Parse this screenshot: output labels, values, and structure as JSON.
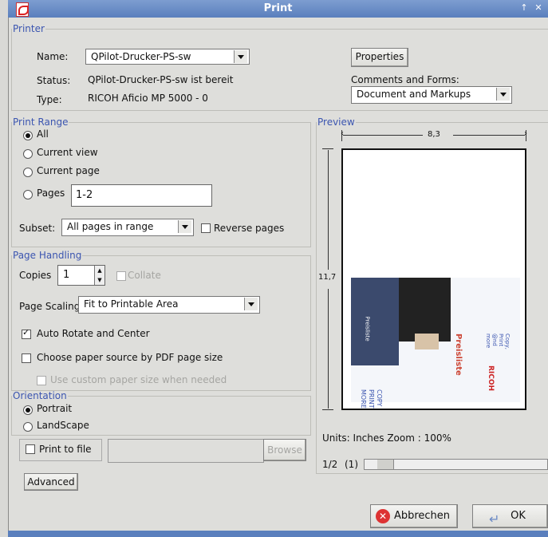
{
  "window": {
    "title": "Print",
    "min_label": "↑",
    "close_label": "✕"
  },
  "printer": {
    "legend": "Printer",
    "name_label": "Name:",
    "name_value": "QPilot-Drucker-PS-sw",
    "status_label": "Status:",
    "status_value": "QPilot-Drucker-PS-sw ist bereit",
    "type_label": "Type:",
    "type_value": "RICOH Aficio MP 5000 -  0",
    "properties_button": "Properties",
    "comments_label": "Comments and Forms:",
    "comments_value": "Document and Markups"
  },
  "print_range": {
    "legend": "Print Range",
    "all": "All",
    "current_view": "Current view",
    "current_page": "Current page",
    "pages": "Pages",
    "pages_value": "1-2",
    "subset_label": "Subset:",
    "subset_value": "All pages in range",
    "reverse": "Reverse pages"
  },
  "page_handling": {
    "legend": "Page Handling",
    "copies_label": "Copies",
    "copies_value": "1",
    "collate": "Collate",
    "scaling_label": "Page Scaling",
    "scaling_value": "Fit to Printable Area",
    "auto_rotate": "Auto Rotate and Center",
    "choose_source": "Choose paper source by PDF page size",
    "custom_size": "Use custom paper size when needed"
  },
  "orientation": {
    "legend": "Orientation",
    "portrait": "Portrait",
    "landscape": "LandScape"
  },
  "print_to_file": {
    "label": "Print to file",
    "browse": "Browse"
  },
  "advanced_button": "Advanced",
  "preview": {
    "legend": "Preview",
    "width_value": "8,3",
    "height_value": "11,7",
    "units_text": "Units: Inches Zoom : 100%",
    "page_indicator": "1/2",
    "page_sub": "(1)",
    "image_texts": {
      "brand": "RICOH",
      "headline": "Preisliste",
      "copy_line": "Copy, Print @nd more",
      "stack": [
        "COPY",
        "PRINT",
        "MORE"
      ],
      "side": "Preisliste"
    }
  },
  "buttons": {
    "cancel": "Abbrechen",
    "ok": "OK"
  }
}
